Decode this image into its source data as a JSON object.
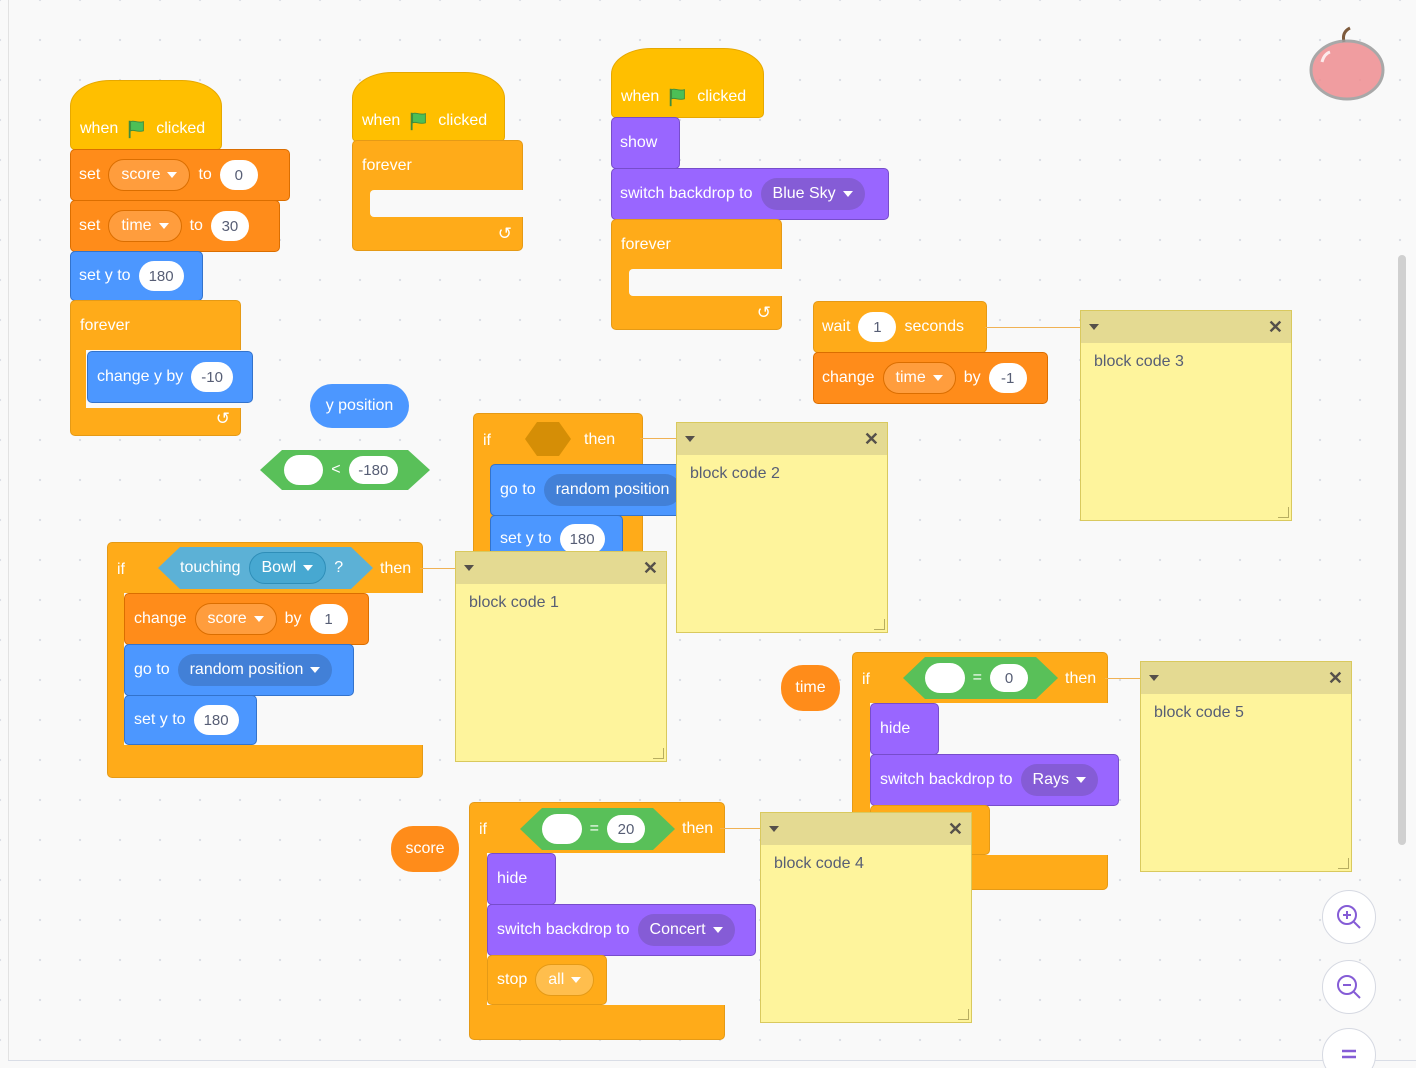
{
  "workspace": {
    "scripts": {
      "s1": {
        "hat": {
          "when": "when",
          "clicked": "clicked"
        },
        "set_score": {
          "set": "set",
          "var": "score",
          "to": "to",
          "value": "0"
        },
        "set_time": {
          "set": "set",
          "var": "time",
          "to": "to",
          "value": "30"
        },
        "set_y": {
          "label": "set y to",
          "value": "180"
        },
        "forever": "forever",
        "change_y": {
          "label": "change y by",
          "value": "-10"
        }
      },
      "s2": {
        "hat": {
          "when": "when",
          "clicked": "clicked"
        },
        "forever": "forever"
      },
      "s3": {
        "hat": {
          "when": "when",
          "clicked": "clicked"
        },
        "show": "show",
        "switch_backdrop": {
          "label": "switch backdrop to",
          "value": "Blue Sky"
        },
        "forever": "forever"
      },
      "s4": {
        "wait": {
          "label": "wait",
          "value": "1",
          "unit": "seconds"
        },
        "change": {
          "label": "change",
          "var": "time",
          "by": "by",
          "value": "-1"
        }
      },
      "s5": {
        "if": "if",
        "then": "then",
        "goto": {
          "label": "go to",
          "value": "random position"
        },
        "set_y": {
          "label": "set y to",
          "value": "180"
        }
      },
      "s6": {
        "if": "if",
        "touching": "touching",
        "object": "Bowl",
        "q": "?",
        "then": "then",
        "change": {
          "label": "change",
          "var": "score",
          "by": "by",
          "value": "1"
        },
        "goto": {
          "label": "go to",
          "value": "random position"
        },
        "set_y": {
          "label": "set y to",
          "value": "180"
        }
      },
      "s7": {
        "if": "if",
        "eq": "=",
        "value": "0",
        "then": "then",
        "hide": "hide",
        "switch_backdrop": {
          "label": "switch backdrop to",
          "value": "Rays"
        }
      },
      "s8": {
        "if": "if",
        "eq": "=",
        "value": "20",
        "then": "then",
        "hide": "hide",
        "switch_backdrop": {
          "label": "switch backdrop to",
          "value": "Concert"
        },
        "stop": {
          "label": "stop",
          "value": "all"
        }
      }
    },
    "loose": {
      "y_position": "y position",
      "lt_op": "<",
      "lt_value": "-180",
      "time_reporter": "time",
      "score_reporter": "score"
    },
    "notes": [
      "block code 1",
      "block code 2",
      "block code 3",
      "block code 4",
      "block code 5"
    ],
    "icons": {
      "flag": "green-flag-icon",
      "sprite": "apple-sprite-icon",
      "zoom_in": "zoom-in-icon",
      "zoom_out": "zoom-out-icon",
      "reset": "zoom-reset-icon"
    },
    "colors": {
      "events": "#ffbf00",
      "control": "#ffab19",
      "variables": "#ff8c1a",
      "motion": "#4c97ff",
      "looks": "#9966ff",
      "operators": "#59c059",
      "sensing": "#5cb1d6",
      "note": "#fef49c"
    }
  }
}
